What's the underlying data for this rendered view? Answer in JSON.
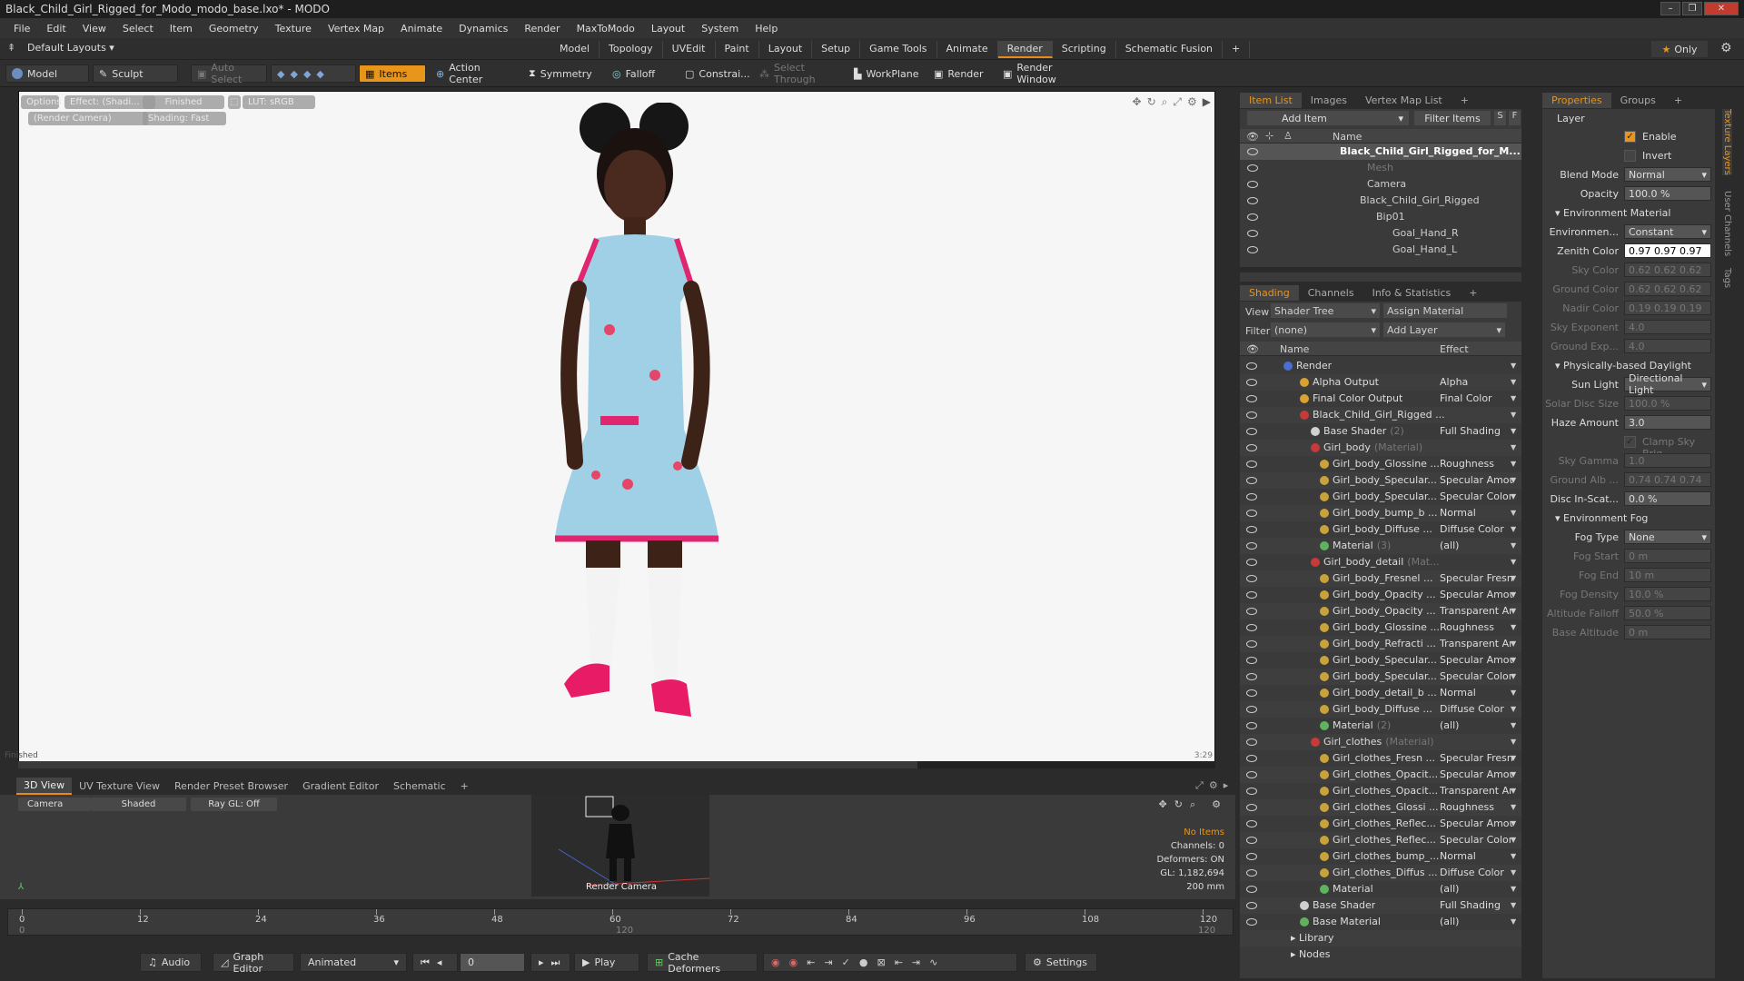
{
  "window": {
    "title": "Black_Child_Girl_Rigged_for_Modo_modo_base.lxo* - MODO"
  },
  "menu": [
    "File",
    "Edit",
    "View",
    "Select",
    "Item",
    "Geometry",
    "Texture",
    "Vertex Map",
    "Animate",
    "Dynamics",
    "Render",
    "MaxToModo",
    "Layout",
    "System",
    "Help"
  ],
  "layoutbar": {
    "layouts_label": "Default Layouts ▾",
    "tabs": [
      "Model",
      "Topology",
      "UVEdit",
      "Paint",
      "Layout",
      "Setup",
      "Game Tools",
      "Animate",
      "Render",
      "Scripting",
      "Schematic Fusion",
      "+"
    ],
    "active_tab": "Render",
    "only": "Only"
  },
  "toolbar": {
    "model": "Model",
    "sculpt": "Sculpt",
    "auto_select": "Auto Select",
    "items": "Items",
    "action_center": "Action Center",
    "symmetry": "Symmetry",
    "falloff": "Falloff",
    "constraints": "Constrai...",
    "select_through": "Select Through",
    "workplane": "WorkPlane",
    "render": "Render",
    "render_window": "Render Window"
  },
  "viewport": {
    "options": "Options",
    "effect": "Effect: (Shadi...",
    "finished": "Finished",
    "lut": "LUT: sRGB",
    "camera": "(Render Camera)",
    "shading": "Shading: Fast",
    "status_left": "Finished",
    "status_right": "3:29"
  },
  "bottom_tabs": [
    "3D View",
    "UV Texture View",
    "Render Preset Browser",
    "Gradient Editor",
    "Schematic",
    "+"
  ],
  "miniview": {
    "camera": "Camera",
    "shaded": "Shaded",
    "raygl": "Ray GL: Off",
    "render_camera_label": "Render Camera",
    "stats": {
      "no_items": "No Items",
      "channels": "Channels: 0",
      "deformers": "Deformers: ON",
      "gl": "GL: 1,182,694",
      "scale": "200 mm"
    }
  },
  "timeline": {
    "ticks": [
      "0",
      "12",
      "24",
      "36",
      "48",
      "60",
      "72",
      "84",
      "96",
      "108",
      "120"
    ],
    "sub_ticks": [
      "0",
      "120",
      "120"
    ]
  },
  "transport": {
    "audio": "Audio",
    "graph_editor": "Graph Editor",
    "animated": "Animated",
    "frame": "0",
    "play": "Play",
    "cache_deformers": "Cache Deformers",
    "settings": "Settings"
  },
  "itemlist": {
    "tabs": [
      "Item List",
      "Images",
      "Vertex Map List",
      "+"
    ],
    "add_item": "Add Item",
    "filter_items": "Filter Items",
    "s": "S",
    "f": "F",
    "col_name": "Name",
    "items": [
      {
        "label": "Black_Child_Girl_Rigged_for_M...",
        "bold": true,
        "indent": 70,
        "dim": false
      },
      {
        "label": "Mesh",
        "bold": false,
        "indent": 100,
        "dim": true
      },
      {
        "label": "Camera",
        "bold": false,
        "indent": 100,
        "dim": false
      },
      {
        "label": "Black_Child_Girl_Rigged",
        "bold": false,
        "indent": 92,
        "dim": false
      },
      {
        "label": "Bip01",
        "bold": false,
        "indent": 110,
        "dim": false
      },
      {
        "label": "Goal_Hand_R",
        "bold": false,
        "indent": 128,
        "dim": false
      },
      {
        "label": "Goal_Hand_L",
        "bold": false,
        "indent": 128,
        "dim": false
      }
    ]
  },
  "shading": {
    "tabs": [
      "Shading",
      "Channels",
      "Info & Statistics",
      "+"
    ],
    "view_label": "View",
    "view_value": "Shader Tree",
    "assign_material": "Assign Material",
    "filter_label": "Filter",
    "filter_value": "(none)",
    "add_layer": "Add Layer",
    "col_name": "Name",
    "col_effect": "Effect",
    "rows": [
      {
        "name": "Render",
        "effect": "",
        "indent": 48,
        "color": "#4a6fd0",
        "dim": ""
      },
      {
        "name": "Alpha Output",
        "effect": "Alpha",
        "indent": 66,
        "color": "#d9a232",
        "dim": ""
      },
      {
        "name": "Final Color Output",
        "effect": "Final Color",
        "indent": 66,
        "color": "#d9a232",
        "dim": ""
      },
      {
        "name": "Black_Child_Girl_Rigged ...",
        "effect": "",
        "indent": 66,
        "color": "#c83a3a",
        "dim": ""
      },
      {
        "name": "Base Shader",
        "effect": "Full Shading",
        "indent": 78,
        "color": "#d0d0d0",
        "dim": "(2)"
      },
      {
        "name": "Girl_body",
        "effect": "",
        "indent": 78,
        "color": "#c83a3a",
        "dim": "(Material)"
      },
      {
        "name": "Girl_body_Glossine ...",
        "effect": "Roughness",
        "indent": 88,
        "color": "#caa23a",
        "dim": ""
      },
      {
        "name": "Girl_body_Specular...",
        "effect": "Specular Amount",
        "indent": 88,
        "color": "#caa23a",
        "dim": ""
      },
      {
        "name": "Girl_body_Specular...",
        "effect": "Specular Color",
        "indent": 88,
        "color": "#caa23a",
        "dim": ""
      },
      {
        "name": "Girl_body_bump_b ...",
        "effect": "Normal",
        "indent": 88,
        "color": "#caa23a",
        "dim": ""
      },
      {
        "name": "Girl_body_Diffuse ...",
        "effect": "Diffuse Color",
        "indent": 88,
        "color": "#caa23a",
        "dim": ""
      },
      {
        "name": "Material",
        "effect": "(all)",
        "indent": 88,
        "color": "#5fb35f",
        "dim": "(3)"
      },
      {
        "name": "Girl_body_detail",
        "effect": "",
        "indent": 78,
        "color": "#c83a3a",
        "dim": "(Mat..."
      },
      {
        "name": "Girl_body_Fresnel ...",
        "effect": "Specular Fresnel",
        "indent": 88,
        "color": "#caa23a",
        "dim": ""
      },
      {
        "name": "Girl_body_Opacity ...",
        "effect": "Specular Amount",
        "indent": 88,
        "color": "#caa23a",
        "dim": ""
      },
      {
        "name": "Girl_body_Opacity ...",
        "effect": "Transparent Am...",
        "indent": 88,
        "color": "#caa23a",
        "dim": ""
      },
      {
        "name": "Girl_body_Glossine ...",
        "effect": "Roughness",
        "indent": 88,
        "color": "#caa23a",
        "dim": ""
      },
      {
        "name": "Girl_body_Refracti ...",
        "effect": "Transparent Am...",
        "indent": 88,
        "color": "#caa23a",
        "dim": ""
      },
      {
        "name": "Girl_body_Specular...",
        "effect": "Specular Amount",
        "indent": 88,
        "color": "#caa23a",
        "dim": ""
      },
      {
        "name": "Girl_body_Specular...",
        "effect": "Specular Color",
        "indent": 88,
        "color": "#caa23a",
        "dim": ""
      },
      {
        "name": "Girl_body_detail_b ...",
        "effect": "Normal",
        "indent": 88,
        "color": "#caa23a",
        "dim": ""
      },
      {
        "name": "Girl_body_Diffuse ...",
        "effect": "Diffuse Color",
        "indent": 88,
        "color": "#caa23a",
        "dim": ""
      },
      {
        "name": "Material",
        "effect": "(all)",
        "indent": 88,
        "color": "#5fb35f",
        "dim": "(2)"
      },
      {
        "name": "Girl_clothes",
        "effect": "",
        "indent": 78,
        "color": "#c83a3a",
        "dim": "(Material)"
      },
      {
        "name": "Girl_clothes_Fresn ...",
        "effect": "Specular Fresnel",
        "indent": 88,
        "color": "#caa23a",
        "dim": ""
      },
      {
        "name": "Girl_clothes_Opacit...",
        "effect": "Specular Amount",
        "indent": 88,
        "color": "#caa23a",
        "dim": ""
      },
      {
        "name": "Girl_clothes_Opacit...",
        "effect": "Transparent Am...",
        "indent": 88,
        "color": "#caa23a",
        "dim": ""
      },
      {
        "name": "Girl_clothes_Glossi ...",
        "effect": "Roughness",
        "indent": 88,
        "color": "#caa23a",
        "dim": ""
      },
      {
        "name": "Girl_clothes_Reflec...",
        "effect": "Specular Amount",
        "indent": 88,
        "color": "#caa23a",
        "dim": ""
      },
      {
        "name": "Girl_clothes_Reflec...",
        "effect": "Specular Color",
        "indent": 88,
        "color": "#caa23a",
        "dim": ""
      },
      {
        "name": "Girl_clothes_bump_...",
        "effect": "Normal",
        "indent": 88,
        "color": "#caa23a",
        "dim": ""
      },
      {
        "name": "Girl_clothes_Diffus ...",
        "effect": "Diffuse Color",
        "indent": 88,
        "color": "#caa23a",
        "dim": ""
      },
      {
        "name": "Material",
        "effect": "(all)",
        "indent": 88,
        "color": "#5fb35f",
        "dim": ""
      },
      {
        "name": "Base Shader",
        "effect": "Full Shading",
        "indent": 66,
        "color": "#d0d0d0",
        "dim": ""
      },
      {
        "name": "Base Material",
        "effect": "(all)",
        "indent": 66,
        "color": "#5fb35f",
        "dim": ""
      },
      {
        "name": "Library",
        "effect": "",
        "indent": 56,
        "color": "",
        "dim": ""
      },
      {
        "name": "Nodes",
        "effect": "",
        "indent": 56,
        "color": "",
        "dim": ""
      }
    ]
  },
  "properties": {
    "tabs": [
      "Properties",
      "Groups",
      "+"
    ],
    "layer": "Layer",
    "rows": [
      {
        "type": "check",
        "label": "Enable",
        "checked": true
      },
      {
        "type": "check",
        "label": "Invert",
        "checked": false
      },
      {
        "type": "select",
        "label": "Blend Mode",
        "value": "Normal",
        "dim": false
      },
      {
        "type": "value",
        "label": "Opacity",
        "value": "100.0 %",
        "dim": false
      },
      {
        "type": "section",
        "label": "Environment Material"
      },
      {
        "type": "select",
        "label": "Environmen...",
        "value": "Constant",
        "dim": false
      },
      {
        "type": "white",
        "label": "Zenith Color",
        "value": "0.97  0.97  0.97",
        "dim": false
      },
      {
        "type": "value",
        "label": "Sky Color",
        "value": "0.62  0.62  0.62",
        "dim": true
      },
      {
        "type": "value",
        "label": "Ground Color",
        "value": "0.62  0.62  0.62",
        "dim": true
      },
      {
        "type": "value",
        "label": "Nadir Color",
        "value": "0.19  0.19  0.19",
        "dim": true
      },
      {
        "type": "value",
        "label": "Sky Exponent",
        "value": "4.0",
        "dim": true
      },
      {
        "type": "value",
        "label": "Ground Exp...",
        "value": "4.0",
        "dim": true
      },
      {
        "type": "section",
        "label": "Physically-based Daylight"
      },
      {
        "type": "select",
        "label": "Sun Light",
        "value": "Directional Light",
        "dim": false
      },
      {
        "type": "value",
        "label": "Solar Disc Size",
        "value": "100.0 %",
        "dim": true
      },
      {
        "type": "value",
        "label": "Haze Amount",
        "value": "3.0",
        "dim": false
      },
      {
        "type": "check",
        "label": "Clamp Sky Brig...",
        "checked": true,
        "dim": true
      },
      {
        "type": "value",
        "label": "Sky Gamma",
        "value": "1.0",
        "dim": true
      },
      {
        "type": "value",
        "label": "Ground Alb ...",
        "value": "0.74  0.74  0.74",
        "dim": true
      },
      {
        "type": "value",
        "label": "Disc In-Scat...",
        "value": "0.0 %",
        "dim": false
      },
      {
        "type": "section",
        "label": "Environment Fog"
      },
      {
        "type": "select",
        "label": "Fog Type",
        "value": "None",
        "dim": false
      },
      {
        "type": "value",
        "label": "Fog Start",
        "value": "0 m",
        "dim": true
      },
      {
        "type": "value",
        "label": "Fog End",
        "value": "10 m",
        "dim": true
      },
      {
        "type": "value",
        "label": "Fog Density",
        "value": "10.0 %",
        "dim": true
      },
      {
        "type": "value",
        "label": "Altitude Falloff",
        "value": "50.0 %",
        "dim": true
      },
      {
        "type": "value",
        "label": "Base Altitude",
        "value": "0 m",
        "dim": true
      }
    ]
  },
  "sidetabs": [
    "Texture Layers",
    "User Channels",
    "Tags"
  ],
  "colors": {
    "accent": "#e8951b",
    "panel": "#3a3a3a",
    "viewport_bg": "#f6f6f6"
  }
}
